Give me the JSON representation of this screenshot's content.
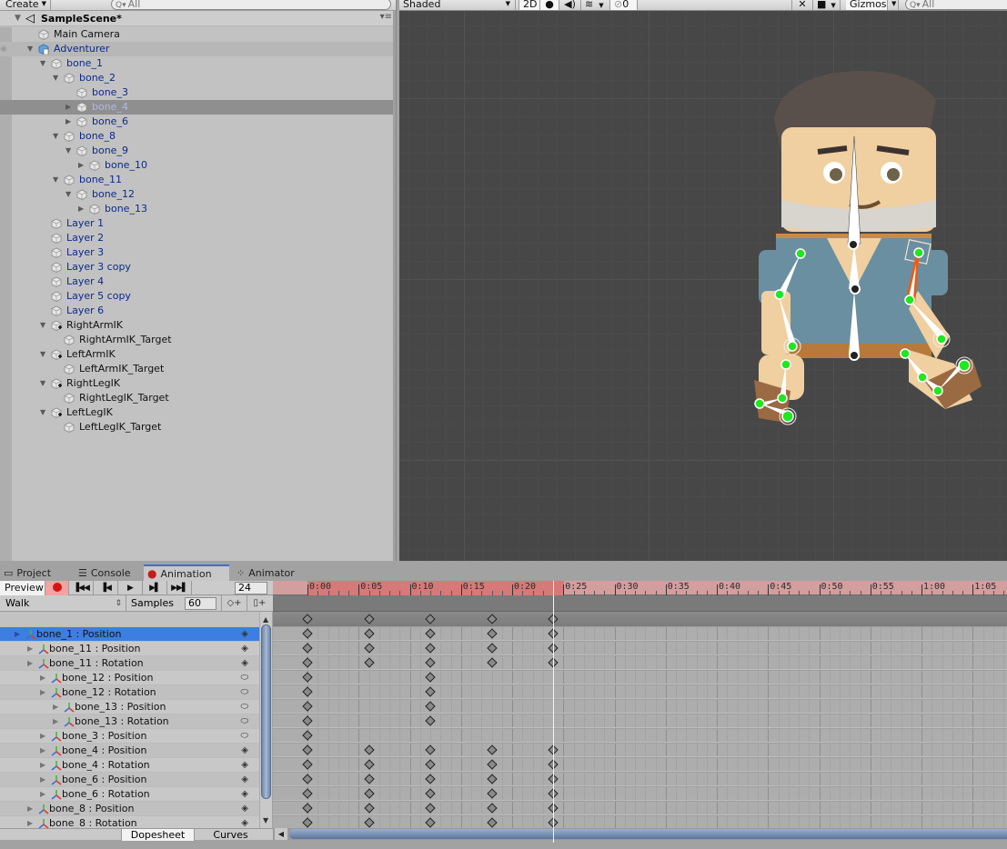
{
  "hierarchy": {
    "create_label": "Create",
    "search_placeholder": "All",
    "scene_name": "SampleScene*",
    "items": [
      {
        "label": "Main Camera",
        "depth": 0,
        "fold": "none",
        "color": "black",
        "icon": "gameobject"
      },
      {
        "label": "Adventurer",
        "depth": 0,
        "fold": "open",
        "color": "blue",
        "icon": "prefab",
        "highlight": true,
        "eye": true
      },
      {
        "label": "bone_1",
        "depth": 1,
        "fold": "open",
        "color": "blue",
        "icon": "gameobject"
      },
      {
        "label": "bone_2",
        "depth": 2,
        "fold": "open",
        "color": "blue",
        "icon": "gameobject"
      },
      {
        "label": "bone_3",
        "depth": 3,
        "fold": "none",
        "color": "blue",
        "icon": "gameobject"
      },
      {
        "label": "bone_4",
        "depth": 3,
        "fold": "closed",
        "color": "blue",
        "icon": "gameobject",
        "selected": true
      },
      {
        "label": "bone_6",
        "depth": 3,
        "fold": "closed",
        "color": "blue",
        "icon": "gameobject"
      },
      {
        "label": "bone_8",
        "depth": 2,
        "fold": "open",
        "color": "blue",
        "icon": "gameobject"
      },
      {
        "label": "bone_9",
        "depth": 3,
        "fold": "open",
        "color": "blue",
        "icon": "gameobject"
      },
      {
        "label": "bone_10",
        "depth": 4,
        "fold": "closed",
        "color": "blue",
        "icon": "gameobject"
      },
      {
        "label": "bone_11",
        "depth": 2,
        "fold": "open",
        "color": "blue",
        "icon": "gameobject"
      },
      {
        "label": "bone_12",
        "depth": 3,
        "fold": "open",
        "color": "blue",
        "icon": "gameobject"
      },
      {
        "label": "bone_13",
        "depth": 4,
        "fold": "closed",
        "color": "blue",
        "icon": "gameobject"
      },
      {
        "label": "Layer 1",
        "depth": 1,
        "fold": "none",
        "color": "blue",
        "icon": "gameobject"
      },
      {
        "label": "Layer 2",
        "depth": 1,
        "fold": "none",
        "color": "blue",
        "icon": "gameobject"
      },
      {
        "label": "Layer 3",
        "depth": 1,
        "fold": "none",
        "color": "blue",
        "icon": "gameobject"
      },
      {
        "label": "Layer 3 copy",
        "depth": 1,
        "fold": "none",
        "color": "blue",
        "icon": "gameobject"
      },
      {
        "label": "Layer 4",
        "depth": 1,
        "fold": "none",
        "color": "blue",
        "icon": "gameobject"
      },
      {
        "label": "Layer 5 copy",
        "depth": 1,
        "fold": "none",
        "color": "blue",
        "icon": "gameobject"
      },
      {
        "label": "Layer 6",
        "depth": 1,
        "fold": "none",
        "color": "blue",
        "icon": "gameobject"
      },
      {
        "label": "RightArmIK",
        "depth": 1,
        "fold": "open",
        "color": "black",
        "icon": "ik"
      },
      {
        "label": "RightArmIK_Target",
        "depth": 2,
        "fold": "none",
        "color": "black",
        "icon": "gameobject"
      },
      {
        "label": "LeftArmIK",
        "depth": 1,
        "fold": "open",
        "color": "black",
        "icon": "ik"
      },
      {
        "label": "LeftArmIK_Target",
        "depth": 2,
        "fold": "none",
        "color": "black",
        "icon": "gameobject"
      },
      {
        "label": "RightLegIK",
        "depth": 1,
        "fold": "open",
        "color": "black",
        "icon": "ik"
      },
      {
        "label": "RightLegIK_Target",
        "depth": 2,
        "fold": "none",
        "color": "black",
        "icon": "gameobject"
      },
      {
        "label": "LeftLegIK",
        "depth": 1,
        "fold": "open",
        "color": "black",
        "icon": "ik"
      },
      {
        "label": "LeftLegIK_Target",
        "depth": 2,
        "fold": "none",
        "color": "black",
        "icon": "gameobject"
      }
    ]
  },
  "scene_toolbar": {
    "shading_mode": "Shaded",
    "mode_2d": "2D",
    "hidden_count": "0",
    "gizmos_label": "Gizmos",
    "search_placeholder": "All"
  },
  "dock": {
    "tabs": [
      {
        "label": "Project",
        "icon": "folder-icon",
        "active": false
      },
      {
        "label": "Console",
        "icon": "console-icon",
        "active": false
      },
      {
        "label": "Animation",
        "icon": "animation-icon",
        "active": true
      },
      {
        "label": "Animator",
        "icon": "animator-icon",
        "active": false
      }
    ]
  },
  "animation": {
    "preview_label": "Preview",
    "current_frame": "24",
    "clip_name": "Walk",
    "samples_label": "Samples",
    "samples_value": "60",
    "view_tabs": [
      "Dopesheet",
      "Curves"
    ],
    "active_view": "Dopesheet",
    "recording": true,
    "playhead_frame": 24,
    "recorded_range_end_frame": 24,
    "ruler_labels": [
      "0:00",
      "0:05",
      "0:10",
      "0:15",
      "0:20",
      "0:25",
      "0:30",
      "0:35",
      "0:40",
      "0:45",
      "0:50",
      "0:55",
      "1:00",
      "1:05"
    ],
    "summary_keys": [
      0,
      6,
      12,
      18,
      24
    ],
    "properties": [
      {
        "label": "bone_1 : Position",
        "depth": 0,
        "selected": true,
        "key_button": "diamond-plus",
        "keys": [
          0,
          6,
          12,
          18,
          24
        ]
      },
      {
        "label": "bone_11 : Position",
        "depth": 1,
        "key_button": "diamond-plus",
        "keys": [
          0,
          6,
          12,
          18,
          24
        ]
      },
      {
        "label": "bone_11 : Rotation",
        "depth": 1,
        "key_button": "diamond-plus",
        "keys": [
          0,
          6,
          12,
          18,
          24
        ]
      },
      {
        "label": "bone_12 : Position",
        "depth": 2,
        "key_button": "oval",
        "keys": [
          0,
          12
        ]
      },
      {
        "label": "bone_12 : Rotation",
        "depth": 2,
        "key_button": "oval",
        "keys": [
          0,
          12
        ]
      },
      {
        "label": "bone_13 : Position",
        "depth": 3,
        "key_button": "oval",
        "keys": [
          0,
          12
        ]
      },
      {
        "label": "bone_13 : Rotation",
        "depth": 3,
        "key_button": "oval",
        "keys": [
          0,
          12
        ]
      },
      {
        "label": "bone_3 : Position",
        "depth": 2,
        "key_button": "oval",
        "keys": [
          0
        ]
      },
      {
        "label": "bone_4 : Position",
        "depth": 2,
        "key_button": "diamond-plus",
        "keys": [
          0,
          6,
          12,
          18,
          24
        ]
      },
      {
        "label": "bone_4 : Rotation",
        "depth": 2,
        "key_button": "diamond-plus",
        "keys": [
          0,
          6,
          12,
          18,
          24
        ]
      },
      {
        "label": "bone_6 : Position",
        "depth": 2,
        "key_button": "diamond-plus",
        "keys": [
          0,
          6,
          12,
          18,
          24
        ]
      },
      {
        "label": "bone_6 : Rotation",
        "depth": 2,
        "key_button": "diamond-plus",
        "keys": [
          0,
          6,
          12,
          18,
          24
        ]
      },
      {
        "label": "bone_8 : Position",
        "depth": 1,
        "key_button": "diamond-plus",
        "keys": [
          0,
          6,
          12,
          18,
          24
        ]
      },
      {
        "label": "bone_8 : Rotation",
        "depth": 1,
        "key_button": "diamond-plus",
        "keys": [
          0,
          6,
          12,
          18,
          24
        ]
      }
    ]
  },
  "colors": {
    "selection_blue": "#3d7ee0",
    "record_red": "#d41414",
    "ruler_recording": "#d57979",
    "bone_green": "#1ee81e",
    "ik_orange": "#f05a10"
  }
}
